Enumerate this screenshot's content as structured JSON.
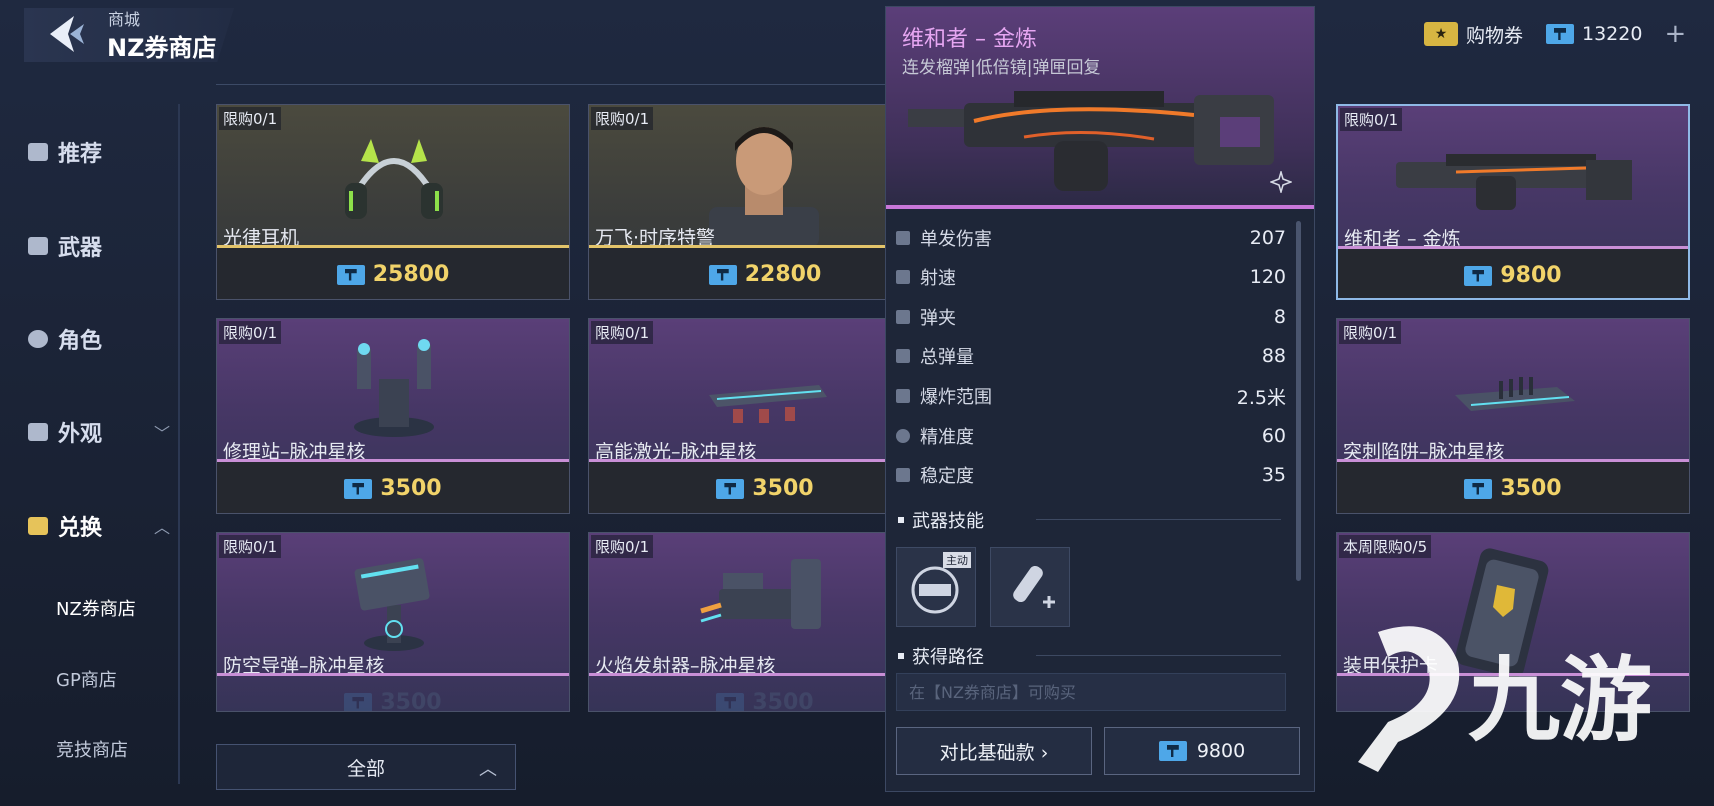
{
  "header": {
    "subtitle": "商城",
    "title": "NZ券商店"
  },
  "currency": {
    "ticket_label": "购物券",
    "ticket_icon": "★",
    "nz_amount": "13220",
    "plus": "+"
  },
  "sidebar": {
    "items": [
      {
        "label": "推荐",
        "icon": "flame-icon"
      },
      {
        "label": "武器",
        "icon": "gun-icon"
      },
      {
        "label": "角色",
        "icon": "person-icon"
      },
      {
        "label": "外观",
        "icon": "spray-icon",
        "chevron": "﹀"
      },
      {
        "label": "兑换",
        "icon": "exchange-icon",
        "chevron": "︿"
      }
    ],
    "subitems": [
      "NZ券商店",
      "GP商店",
      "竞技商店"
    ]
  },
  "cards": [
    {
      "limit": "限购0/1",
      "name": "光律耳机",
      "price": "25800"
    },
    {
      "limit": "限购0/1",
      "name": "万飞·时序特警",
      "price": "22800"
    },
    {
      "limit": "限购0/1",
      "name": "维和者 – 金炼",
      "price": "9800"
    },
    {
      "limit": "限购0/1",
      "name": "修理站–脉冲星核",
      "price": "3500"
    },
    {
      "limit": "限购0/1",
      "name": "高能激光–脉冲星核",
      "price": "3500"
    },
    {
      "limit": "限购0/1",
      "name": "突刺陷阱–脉冲星核",
      "price": "3500"
    },
    {
      "limit": "限购0/1",
      "name": "防空导弹–脉冲星核",
      "price": "3500"
    },
    {
      "limit": "限购0/1",
      "name": "火焰发射器–脉冲星核",
      "price": "3500"
    },
    {
      "limit": "本周限购0/5",
      "name": "装甲保护卡"
    }
  ],
  "detail": {
    "title": "维和者 – 金炼",
    "subtitle": "连发榴弹|低倍镜|弹匣回复",
    "stats": [
      {
        "label": "单发伤害",
        "value": "207"
      },
      {
        "label": "射速",
        "value": "120"
      },
      {
        "label": "弹夹",
        "value": "8"
      },
      {
        "label": "总弹量",
        "value": "88"
      },
      {
        "label": "爆炸范围",
        "value": "2.5米"
      },
      {
        "label": "精准度",
        "value": "60"
      },
      {
        "label": "稳定度",
        "value": "35"
      }
    ],
    "skills_title": "武器技能",
    "skill_tag": "主动",
    "route_title": "获得路径",
    "route_text": "在【NZ券商店】可购买",
    "compare_label": "对比基础款 ›",
    "buy_price": "9800"
  },
  "filter": {
    "label": "全部",
    "chevron": "︿"
  },
  "watermark": {
    "text": "九游"
  }
}
